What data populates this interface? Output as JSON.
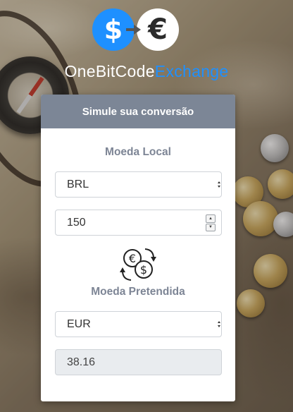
{
  "logo": {
    "name_part1": "OneBitCode",
    "name_part2": "Exchange",
    "dollar_symbol": "$",
    "euro_symbol": "€",
    "accent_color": "#1e90ff"
  },
  "card": {
    "title": "Simule sua conversão",
    "local_label": "Moeda Local",
    "local_currency": "BRL",
    "amount": "150",
    "target_label": "Moeda Pretendida",
    "target_currency": "EUR",
    "result": "38.16",
    "header_color": "#7c8696",
    "icon": "currency-exchange-icon"
  }
}
